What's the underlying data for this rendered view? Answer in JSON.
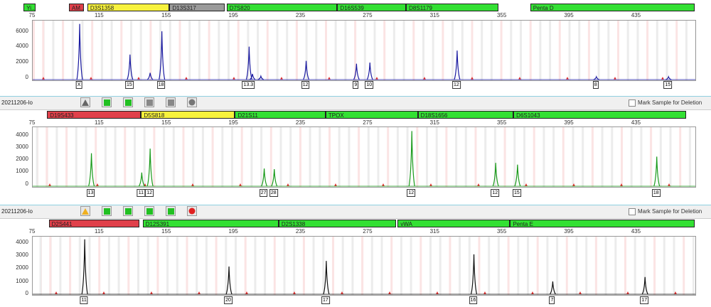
{
  "range": {
    "min": 75,
    "max": 470
  },
  "xticks": [
    "75",
    "115",
    "155",
    "195",
    "235",
    "275",
    "315",
    "355",
    "395",
    "435"
  ],
  "panels": [
    {
      "ymax": 7000,
      "yticks": [
        "6000",
        "4000",
        "2000",
        "0"
      ],
      "trace_color": "#1a1aa0",
      "markers": [
        {
          "label": "Yi...",
          "color": "green",
          "start": 70,
          "end": 77
        },
        {
          "label": "AM...",
          "color": "red",
          "start": 97,
          "end": 106
        },
        {
          "label": "D3S1358",
          "color": "yellow",
          "start": 108,
          "end": 157
        },
        {
          "label": "D13S317",
          "color": "gray",
          "start": 157,
          "end": 190
        },
        {
          "label": "D7S820",
          "color": "green",
          "start": 191,
          "end": 257
        },
        {
          "label": "D16S539",
          "color": "green",
          "start": 257,
          "end": 298
        },
        {
          "label": "D8S1179",
          "color": "green",
          "start": 298,
          "end": 353
        },
        {
          "label": "Penta D",
          "color": "green",
          "start": 372,
          "end": 470
        }
      ],
      "peaks": [
        {
          "x": 103,
          "h": 0.98
        },
        {
          "x": 133,
          "h": 0.44
        },
        {
          "x": 145,
          "h": 0.12
        },
        {
          "x": 152,
          "h": 0.85
        },
        {
          "x": 204,
          "h": 0.58
        },
        {
          "x": 206,
          "h": 0.1
        },
        {
          "x": 211,
          "h": 0.06
        },
        {
          "x": 238,
          "h": 0.33
        },
        {
          "x": 268,
          "h": 0.28
        },
        {
          "x": 276,
          "h": 0.3
        },
        {
          "x": 328,
          "h": 0.51
        },
        {
          "x": 411,
          "h": 0.05
        },
        {
          "x": 454,
          "h": 0.05
        }
      ],
      "alleles": [
        {
          "x": 103,
          "label": "X"
        },
        {
          "x": 133,
          "label": "15"
        },
        {
          "x": 152,
          "label": "18"
        },
        {
          "x": 204,
          "label": "13.3"
        },
        {
          "x": 238,
          "label": "12"
        },
        {
          "x": 268,
          "label": "9"
        },
        {
          "x": 276,
          "label": "10"
        },
        {
          "x": 328,
          "label": "12"
        },
        {
          "x": 411,
          "label": "8"
        },
        {
          "x": 454,
          "label": "15"
        }
      ]
    },
    {
      "ymax": 4700,
      "yticks": [
        "4000",
        "3000",
        "2000",
        "1000",
        "0"
      ],
      "trace_color": "#1a9a1a",
      "markers": [
        {
          "label": "D19S433",
          "color": "red",
          "start": 84,
          "end": 140
        },
        {
          "label": "D5S818",
          "color": "yellow",
          "start": 140,
          "end": 196
        },
        {
          "label": "D21S11",
          "color": "green",
          "start": 196,
          "end": 250
        },
        {
          "label": "TPOX",
          "color": "green",
          "start": 250,
          "end": 305
        },
        {
          "label": "D18S1656",
          "color": "green",
          "start": 305,
          "end": 362
        },
        {
          "label": "D6S1043",
          "color": "green",
          "start": 362,
          "end": 465
        }
      ],
      "peaks": [
        {
          "x": 110,
          "h": 0.58
        },
        {
          "x": 140,
          "h": 0.24
        },
        {
          "x": 145,
          "h": 0.66
        },
        {
          "x": 213,
          "h": 0.31
        },
        {
          "x": 219,
          "h": 0.3
        },
        {
          "x": 301,
          "h": 0.97
        },
        {
          "x": 351,
          "h": 0.41
        },
        {
          "x": 364,
          "h": 0.38
        },
        {
          "x": 447,
          "h": 0.52
        }
      ],
      "alleles": [
        {
          "x": 110,
          "label": "13"
        },
        {
          "x": 140,
          "label": "11"
        },
        {
          "x": 145,
          "label": "12"
        },
        {
          "x": 213,
          "label": "27"
        },
        {
          "x": 219,
          "label": "28"
        },
        {
          "x": 301,
          "label": "12"
        },
        {
          "x": 351,
          "label": "12"
        },
        {
          "x": 364,
          "label": "15"
        },
        {
          "x": 447,
          "label": "18"
        }
      ]
    },
    {
      "ymax": 4300,
      "yticks": [
        "4000",
        "3000",
        "2000",
        "1000",
        "0"
      ],
      "trace_color": "#111111",
      "markers": [
        {
          "label": "D2S441",
          "color": "red",
          "start": 85,
          "end": 139
        },
        {
          "label": "D12S391",
          "color": "green",
          "start": 141,
          "end": 222
        },
        {
          "label": "D2S1338",
          "color": "green",
          "start": 222,
          "end": 292
        },
        {
          "label": "vWA",
          "color": "green",
          "start": 293,
          "end": 360
        },
        {
          "label": "Penta E",
          "color": "green",
          "start": 360,
          "end": 470
        }
      ],
      "peaks": [
        {
          "x": 106,
          "h": 0.99
        },
        {
          "x": 192,
          "h": 0.5
        },
        {
          "x": 250,
          "h": 0.6
        },
        {
          "x": 338,
          "h": 0.72
        },
        {
          "x": 385,
          "h": 0.23
        },
        {
          "x": 440,
          "h": 0.31
        }
      ],
      "alleles": [
        {
          "x": 106,
          "label": "11"
        },
        {
          "x": 192,
          "label": "20"
        },
        {
          "x": 250,
          "label": "17"
        },
        {
          "x": 338,
          "label": "16"
        },
        {
          "x": 385,
          "label": "7"
        },
        {
          "x": 440,
          "label": "17"
        }
      ]
    }
  ],
  "sample_bars": [
    {
      "sample": "20211206-lo",
      "mark_label": "Mark Sample for Deletion",
      "icons": [
        "triangle-gray-icon",
        "green-square-icon",
        "green-square-icon",
        "gray-square-icon",
        "gray-square-icon",
        "gray-circle-icon"
      ]
    },
    {
      "sample": "20211206-lo",
      "mark_label": "Mark Sample for Deletion",
      "icons": [
        "triangle-warning-icon",
        "green-square-icon",
        "green-square-icon",
        "green-square-icon",
        "green-square-icon",
        "red-circle-icon"
      ]
    }
  ]
}
